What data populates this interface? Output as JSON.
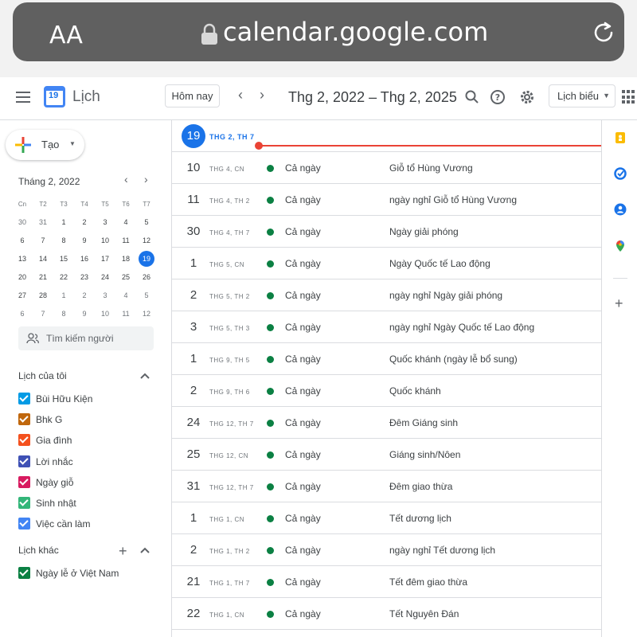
{
  "browser": {
    "text_size_label": "AA",
    "url": "calendar.google.com"
  },
  "header": {
    "app_title": "Lịch",
    "today_button": "Hôm nay",
    "date_range": "Thg 2, 2022 – Thg 2, 2025",
    "view_selector": "Lịch biểu"
  },
  "sidebar": {
    "create_label": "Tạo",
    "mini_calendar": {
      "month_title": "Tháng 2, 2022",
      "weekday_headers": [
        "Cn",
        "T2",
        "T3",
        "T4",
        "T5",
        "T6",
        "T7"
      ],
      "weeks": [
        [
          "30",
          "31",
          "1",
          "2",
          "3",
          "4",
          "5"
        ],
        [
          "6",
          "7",
          "8",
          "9",
          "10",
          "11",
          "12"
        ],
        [
          "13",
          "14",
          "15",
          "16",
          "17",
          "18",
          "19"
        ],
        [
          "20",
          "21",
          "22",
          "23",
          "24",
          "25",
          "26"
        ],
        [
          "27",
          "28",
          "1",
          "2",
          "3",
          "4",
          "5"
        ],
        [
          "6",
          "7",
          "8",
          "9",
          "10",
          "11",
          "12"
        ]
      ],
      "selected_day": "19"
    },
    "search_people_placeholder": "Tìm kiếm người",
    "my_calendars_title": "Lịch của tôi",
    "my_calendars": [
      {
        "label": "Bùi Hữu Kiện",
        "color": "#039be5"
      },
      {
        "label": "Bhk G",
        "color": "#c0670d"
      },
      {
        "label": "Gia đình",
        "color": "#f4511e"
      },
      {
        "label": "Lời nhắc",
        "color": "#3f51b5"
      },
      {
        "label": "Ngày giỗ",
        "color": "#d81b60"
      },
      {
        "label": "Sinh nhật",
        "color": "#33b679"
      },
      {
        "label": "Việc cần làm",
        "color": "#4285f4"
      }
    ],
    "other_calendars_title": "Lịch khác",
    "other_calendars": [
      {
        "label": "Ngày lễ ở Việt Nam",
        "color": "#0b8043"
      }
    ]
  },
  "agenda": {
    "today": {
      "day": "19",
      "label": "THG 2, TH 7"
    },
    "events": [
      {
        "day": "10",
        "weekday": "THG 4, CN",
        "time": "Cả ngày",
        "title": "Giỗ tổ Hùng Vương"
      },
      {
        "day": "11",
        "weekday": "THG 4, TH 2",
        "time": "Cả ngày",
        "title": "ngày nghỉ Giỗ tổ Hùng Vương"
      },
      {
        "day": "30",
        "weekday": "THG 4, TH 7",
        "time": "Cả ngày",
        "title": "Ngày giải phóng"
      },
      {
        "day": "1",
        "weekday": "THG 5, CN",
        "time": "Cả ngày",
        "title": "Ngày Quốc tế Lao động"
      },
      {
        "day": "2",
        "weekday": "THG 5, TH 2",
        "time": "Cả ngày",
        "title": "ngày nghỉ Ngày giải phóng"
      },
      {
        "day": "3",
        "weekday": "THG 5, TH 3",
        "time": "Cả ngày",
        "title": "ngày nghỉ Ngày Quốc tế Lao động"
      },
      {
        "day": "1",
        "weekday": "THG 9, TH 5",
        "time": "Cả ngày",
        "title": "Quốc khánh (ngày lễ bổ sung)"
      },
      {
        "day": "2",
        "weekday": "THG 9, TH 6",
        "time": "Cả ngày",
        "title": "Quốc khánh"
      },
      {
        "day": "24",
        "weekday": "THG 12, TH 7",
        "time": "Cả ngày",
        "title": "Đêm Giáng sinh"
      },
      {
        "day": "25",
        "weekday": "THG 12, CN",
        "time": "Cả ngày",
        "title": "Giáng sinh/Nôen"
      },
      {
        "day": "31",
        "weekday": "THG 12, TH 7",
        "time": "Cả ngày",
        "title": "Đêm giao thừa"
      },
      {
        "day": "1",
        "weekday": "THG 1, CN",
        "time": "Cả ngày",
        "title": "Tết dương lịch"
      },
      {
        "day": "2",
        "weekday": "THG 1, TH 2",
        "time": "Cả ngày",
        "title": "ngày nghỉ Tết dương lịch"
      },
      {
        "day": "21",
        "weekday": "THG 1, TH 7",
        "time": "Cả ngày",
        "title": "Tết đêm giao thừa"
      },
      {
        "day": "22",
        "weekday": "THG 1, CN",
        "time": "Cả ngày",
        "title": "Tết Nguyên Đán"
      }
    ],
    "event_color": "#0b8043",
    "now_line_color": "#ea4335"
  },
  "right_rail": {
    "icons": [
      "keep-icon",
      "tasks-icon",
      "contacts-icon",
      "maps-icon",
      "add-icon"
    ]
  }
}
